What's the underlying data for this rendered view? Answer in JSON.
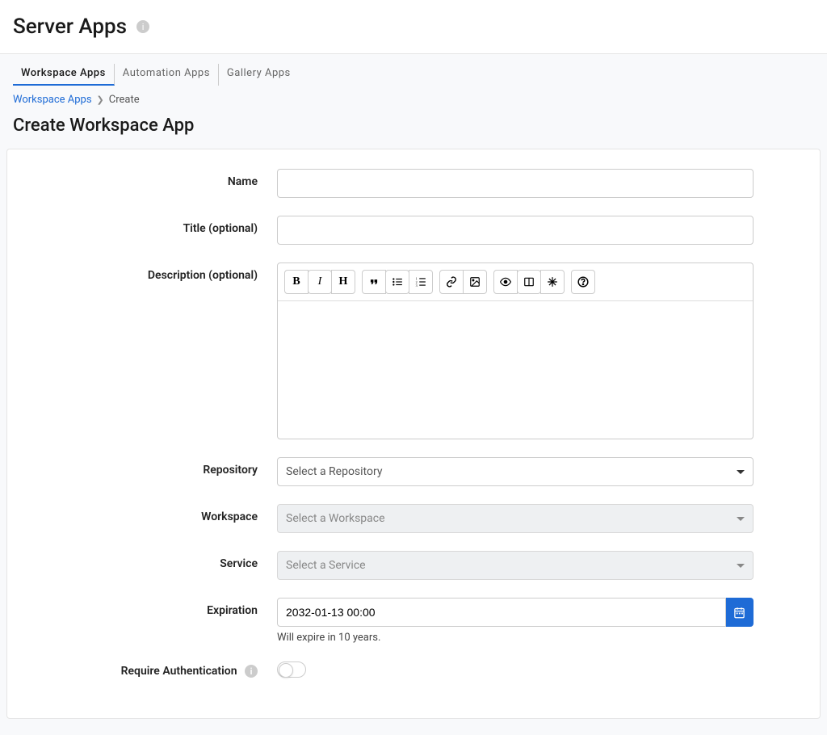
{
  "header": {
    "title": "Server Apps"
  },
  "tabs": [
    {
      "label": "Workspace Apps",
      "active": true
    },
    {
      "label": "Automation Apps",
      "active": false
    },
    {
      "label": "Gallery Apps",
      "active": false
    }
  ],
  "breadcrumb": {
    "root": "Workspace Apps",
    "current": "Create"
  },
  "section_title": "Create Workspace App",
  "form": {
    "name": {
      "label": "Name",
      "value": ""
    },
    "title": {
      "label": "Title (optional)",
      "value": ""
    },
    "description": {
      "label": "Description (optional)",
      "value": ""
    },
    "repository": {
      "label": "Repository",
      "placeholder": "Select a Repository",
      "disabled": false
    },
    "workspace": {
      "label": "Workspace",
      "placeholder": "Select a Workspace",
      "disabled": true
    },
    "service": {
      "label": "Service",
      "placeholder": "Select a Service",
      "disabled": true
    },
    "expiration": {
      "label": "Expiration",
      "value": "2032-01-13 00:00",
      "helper": "Will expire in 10 years."
    },
    "require_auth": {
      "label": "Require Authentication",
      "value": false
    }
  }
}
